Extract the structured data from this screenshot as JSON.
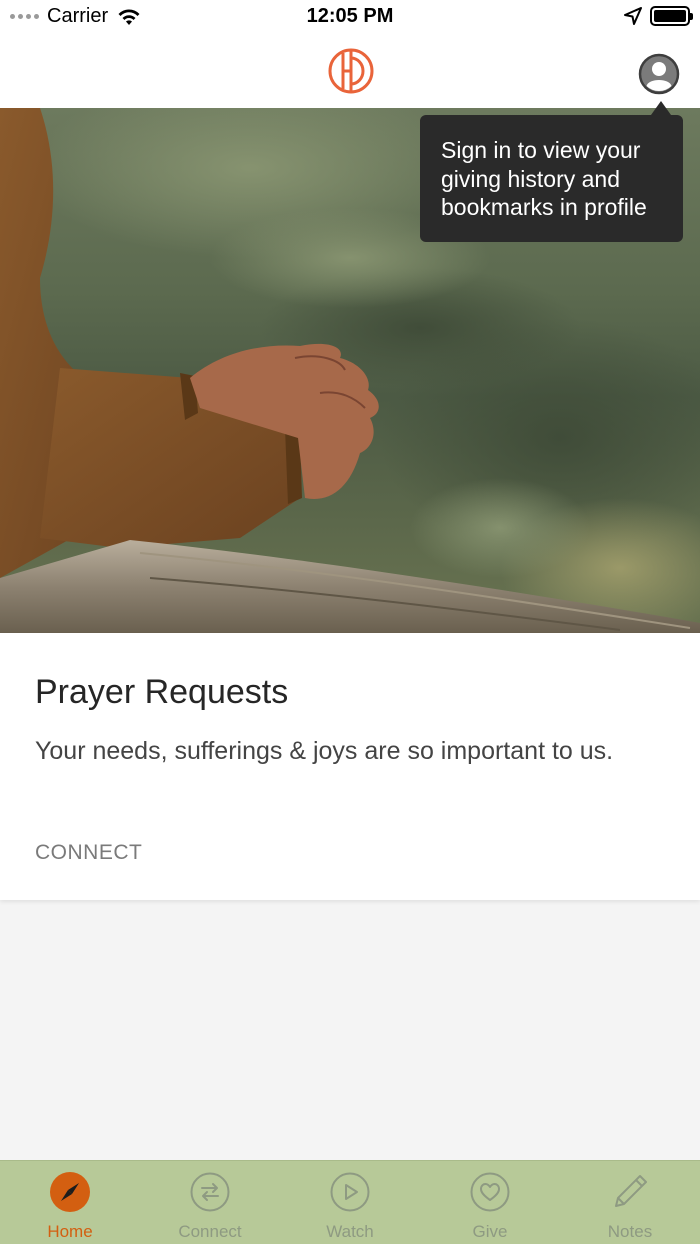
{
  "status_bar": {
    "carrier": "Carrier",
    "time": "12:05 PM"
  },
  "header": {
    "logo_icon": "church-logo-icon",
    "profile_icon": "user-profile-icon"
  },
  "tooltip": {
    "text": "Sign in to view your giving history and bookmarks in profile"
  },
  "card": {
    "title": "Prayer Requests",
    "summary": "Your needs, sufferings & joys are so important to us.",
    "category": "CONNECT"
  },
  "tab_bar": {
    "tabs": [
      {
        "label": "Home",
        "icon": "compass-icon",
        "active": true
      },
      {
        "label": "Connect",
        "icon": "connect-arrows-icon",
        "active": false
      },
      {
        "label": "Watch",
        "icon": "play-icon",
        "active": false
      },
      {
        "label": "Give",
        "icon": "heart-icon",
        "active": false
      },
      {
        "label": "Notes",
        "icon": "pencil-icon",
        "active": false
      }
    ]
  },
  "colors": {
    "accent": "#E9643A",
    "tab_bar_bg": "#B7C998",
    "tab_active": "#D35F11",
    "tab_inactive": "#8E9A82",
    "tooltip_bg": "#2A2A2A"
  }
}
